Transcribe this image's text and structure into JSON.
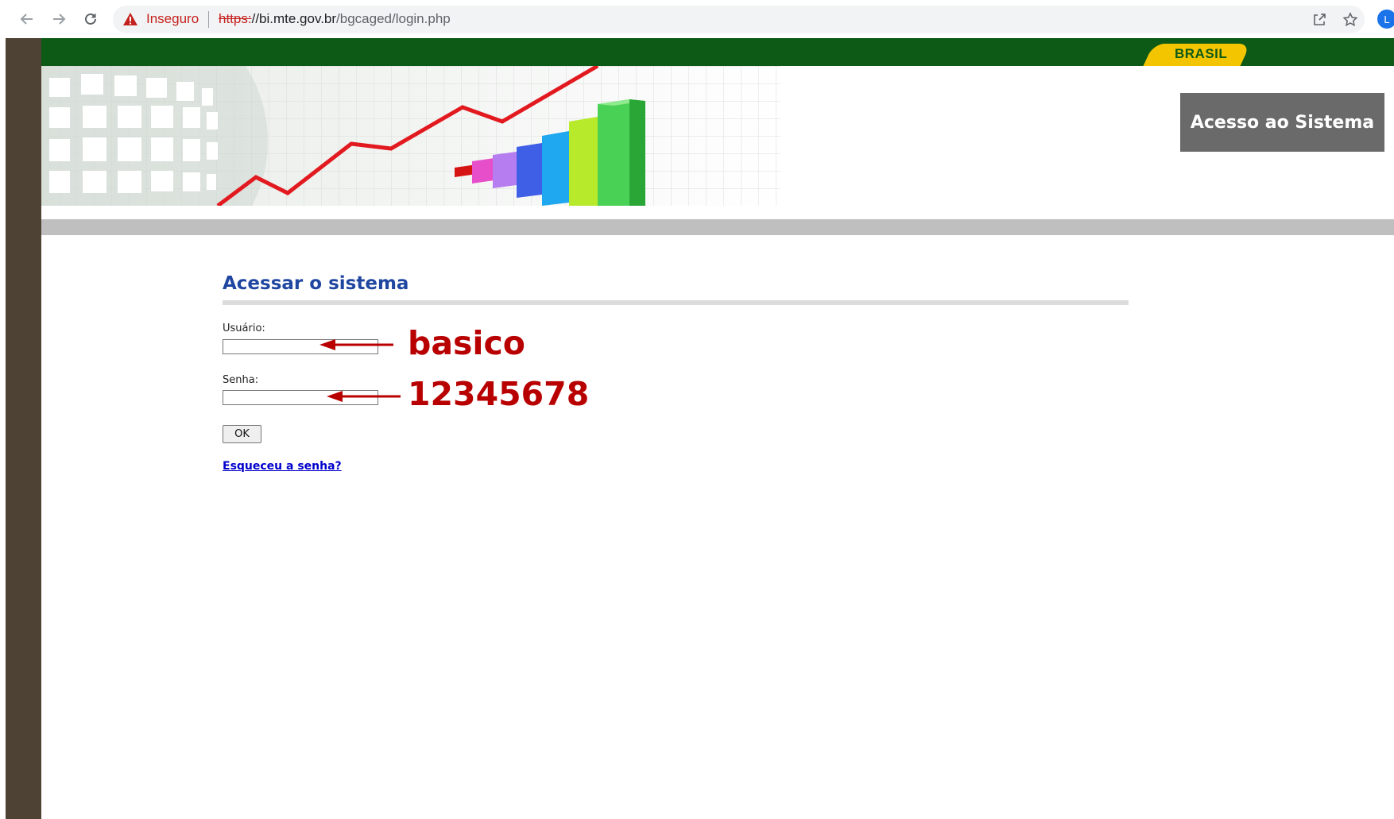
{
  "browser": {
    "security_label": "Inseguro",
    "url_scheme": "https:",
    "url_host": "//bi.mte.gov.br",
    "url_path": "/bgcaged/login.php",
    "profile_initial": "L"
  },
  "header": {
    "gov_logo_text": "BRASIL",
    "access_label": "Acesso ao Sistema"
  },
  "login": {
    "title": "Acessar o sistema",
    "user_label": "Usuário:",
    "user_value": "",
    "password_label": "Senha:",
    "password_value": "",
    "submit_label": "OK",
    "forgot_link": "Esqueceu a senha?"
  },
  "annotations": {
    "user_hint": "basico",
    "password_hint": "12345678"
  },
  "colors": {
    "gov_green": "#0d5a16",
    "gov_yellow": "#f3c500",
    "heading_blue": "#1f46a0",
    "annotation_red": "#b80000"
  }
}
